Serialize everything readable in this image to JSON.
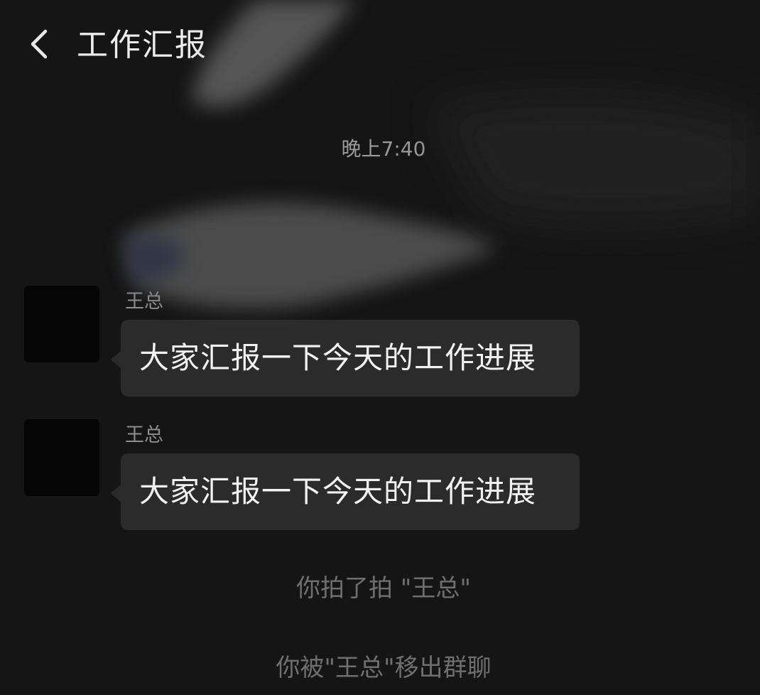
{
  "header": {
    "title": "工作汇报",
    "back_icon": "chevron-left-icon"
  },
  "chat": {
    "timestamp": "晚上7:40",
    "messages": [
      {
        "sender": "王总",
        "text": "大家汇报一下今天的工作进展"
      },
      {
        "sender": "王总",
        "text": "大家汇报一下今天的工作进展"
      }
    ],
    "system_messages": [
      "你拍了拍 \"王总\"",
      "你被\"王总\"移出群聊"
    ]
  },
  "colors": {
    "background": "#151515",
    "bubble": "#2b2b2b",
    "bubble_text": "#f2f2f2",
    "system_text": "#6f6f6f"
  }
}
